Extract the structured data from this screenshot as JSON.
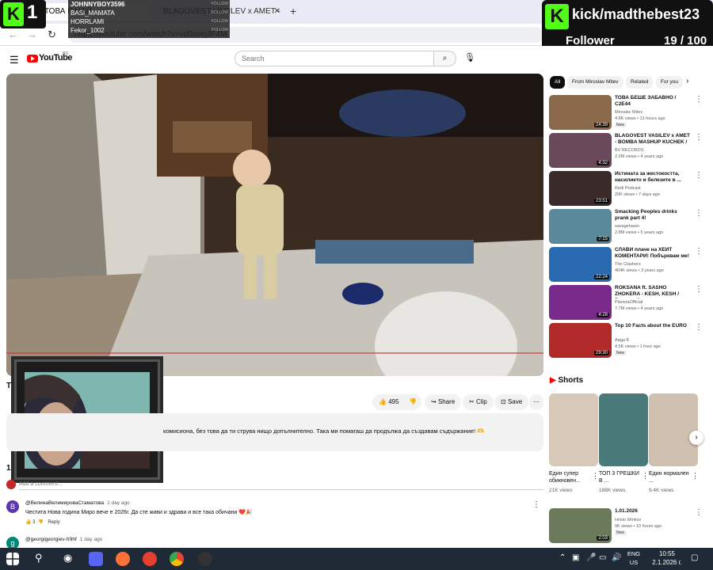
{
  "browser": {
    "tab1_title": "ТОВА Е НАЙ...",
    "tab2_title": "BLAGOVEST VASILEV x AMET -",
    "url": "https://youtube.com/watch?v=vd5xoej4F4M"
  },
  "kick_overlay": {
    "logo_number": "1",
    "chat": [
      {
        "name": "JOHNNYBOY3596",
        "follow": "FOLLOW"
      },
      {
        "name": "BASI_MAMATA",
        "follow": "FOLLOW"
      },
      {
        "name": "HORRLAMI",
        "follow": "FOLLOW"
      },
      {
        "name": "Fekor_1002",
        "follow": "FOLLOW"
      }
    ],
    "username": "kick/madthebest23",
    "follower_label": "Follower",
    "follower_count": "19 / 100",
    "follower_progress": 0.19
  },
  "youtube": {
    "logo_text": "YouTube",
    "logo_sup": "BG",
    "search_placeholder": "Search",
    "title_fragment": "T",
    "likes": "495",
    "share": "Share",
    "clip": "Clip",
    "save": "Save",
    "description": "комисиона, без това да ти струва нищо допълнително. Така ми помагаш да продължа да създавам съдържание! 🫶",
    "comments_count": "1",
    "add_comment": "Add a comment...",
    "comments": [
      {
        "avatar": "B",
        "avatar_color": "#5e35b1",
        "author": "@ВелинаВелимироваСтаматова",
        "time": "1 day ago",
        "text": "Честита Нова година Миро вече е 2026г. Да сте живи и здрави и все така обичани ❤️🎉",
        "likes": "3",
        "reply": "Reply"
      },
      {
        "avatar": "g",
        "avatar_color": "#00897b",
        "author": "@georgigeorgiev-fr9hf",
        "time": "1 day ago",
        "text": "",
        "likes": "",
        "reply": ""
      }
    ],
    "chips": [
      "All",
      "From Miroslav Mitev",
      "Related",
      "For you"
    ],
    "recommendations": [
      {
        "title": "ТОВА БЕШЕ ЗАБАВНО / C2E44",
        "channel": "Miroslav Mitev",
        "meta": "4.8K views • 13 hours ago",
        "badge": "New",
        "duration": "24:39",
        "color": "#8a6a4a"
      },
      {
        "title": "BLAGOVEST VASILEV x AMET - BOMBA MASHUP KUCHEK / ...",
        "channel": "BV RECORDS",
        "meta": "2.2M views • 4 years ago",
        "badge": "",
        "duration": "4:32",
        "color": "#6a4a5a"
      },
      {
        "title": "Истината за жестокостта, насилието и белезите в ...",
        "channel": "Redi Podcast",
        "meta": "20K views • 7 days ago",
        "badge": "",
        "duration": "23:51",
        "color": "#3a2a2a"
      },
      {
        "title": "Smacking Peoples drinks prank part 4!",
        "channel": "savagehawn",
        "meta": "2.8M views • 5 years ago",
        "badge": "",
        "duration": "7:15",
        "color": "#5a8a9a"
      },
      {
        "title": "СЛАВИ плаче на ХЕЙТ КОМЕНТАРИ! Побърквам ме!",
        "channel": "The Clashers",
        "meta": "404K views • 3 years ago",
        "badge": "",
        "duration": "22:24",
        "color": "#2a6ab0"
      },
      {
        "title": "ROKSANA ft. SASHO ZHOKERA - KESH, KESH / Рокcана ft. ...",
        "channel": "PlanetaOfficial",
        "meta": "7.7M views • 4 years ago",
        "badge": "",
        "duration": "4:28",
        "color": "#7a2a8a"
      },
      {
        "title": "Top 10 Facts about the EURO",
        "channel": "Аида Б",
        "meta": "4.5K views • 1 hour ago",
        "badge": "New",
        "duration": "29:30",
        "color": "#b02a2a"
      }
    ],
    "shorts_header": "Shorts",
    "shorts": [
      {
        "title": "Един супер обикновен...",
        "views": "21K views",
        "color": "#d8c8b8"
      },
      {
        "title": "ТОП 3 ГРЕШКИ В ...",
        "views": "188K views",
        "color": "#4a7a7a"
      },
      {
        "title": "Един нормален ...",
        "views": "9.4K views",
        "color": "#d0c0b0"
      }
    ],
    "bottom_rec": {
      "title": "1.01.2026",
      "channel": "Hristo Minkov",
      "meta": "9K views • 10 hours ago",
      "badge": "New",
      "duration": "2:03"
    }
  },
  "taskbar": {
    "lang1": "ENG",
    "lang2": "US",
    "time": "10:55",
    "date": "2.1.2026 г."
  }
}
